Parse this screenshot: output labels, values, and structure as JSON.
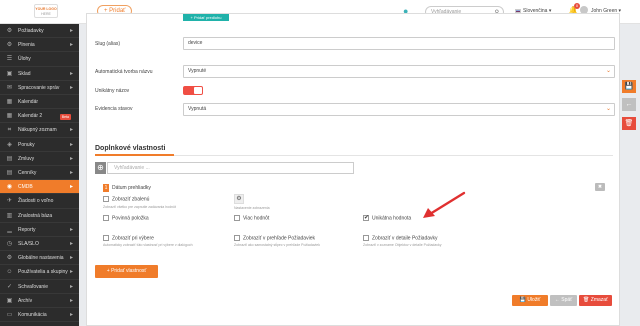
{
  "topbar": {
    "logo_line1": "YOUR LOGO",
    "logo_line2": "HERE",
    "add_button": "+ Pridať",
    "search_placeholder": "Vyhľadávanie",
    "language": "Slovenčina",
    "notification_count": "0",
    "user_name": "John Green"
  },
  "sidebar": {
    "items": [
      {
        "label": "Požiadavky",
        "icon": "gear-icon",
        "chevron": true
      },
      {
        "label": "Plnenia",
        "icon": "cogs-icon",
        "chevron": true
      },
      {
        "label": "Úlohy",
        "icon": "tasks-icon",
        "chevron": false
      },
      {
        "label": "Sklad",
        "icon": "box-icon",
        "chevron": true
      },
      {
        "label": "Spracovanie správ",
        "icon": "envelope-icon",
        "chevron": true
      },
      {
        "label": "Kalendár",
        "icon": "calendar-icon",
        "chevron": false
      },
      {
        "label": "Kalendár 2",
        "icon": "calendar-icon",
        "chevron": false,
        "badge": "Beta"
      },
      {
        "label": "Nákupný zoznam",
        "icon": "cart-icon",
        "chevron": true
      },
      {
        "label": "Ponuky",
        "icon": "tag-icon",
        "chevron": true
      },
      {
        "label": "Zmluvy",
        "icon": "document-icon",
        "chevron": true
      },
      {
        "label": "Cenníky",
        "icon": "pricelist-icon",
        "chevron": true
      },
      {
        "label": "CMDB",
        "icon": "database-icon",
        "chevron": true,
        "active": true
      },
      {
        "label": "Žiadosti o voľno",
        "icon": "plane-icon",
        "chevron": false
      },
      {
        "label": "Znalostná báza",
        "icon": "book-icon",
        "chevron": false
      },
      {
        "label": "Reporty",
        "icon": "chart-icon",
        "chevron": true
      },
      {
        "label": "SLA/SLO",
        "icon": "clock-icon",
        "chevron": true
      },
      {
        "label": "Globálne nastavenia",
        "icon": "settings-icon",
        "chevron": true
      },
      {
        "label": "Používatelia a skupiny",
        "icon": "users-icon",
        "chevron": true
      },
      {
        "label": "Schvaľovanie",
        "icon": "check-icon",
        "chevron": true
      },
      {
        "label": "Archív",
        "icon": "archive-icon",
        "chevron": true
      },
      {
        "label": "Komunikácia",
        "icon": "chat-icon",
        "chevron": true
      }
    ]
  },
  "form": {
    "teal_button": "+ Pridať predlohu",
    "slug_label": "Slug (alias)",
    "slug_value": "device",
    "auto_name_label": "Automatická tvorba názvu",
    "auto_name_value": "Vypnuté",
    "unique_name_label": "Unikátny názov",
    "state_label": "Evidencia stavov",
    "state_value": "Vypnutá"
  },
  "extra": {
    "section_title": "Doplnkové vlastnosti",
    "search_placeholder": "Vyhľadávanie ...",
    "prop_number": "1",
    "prop_name": "Dátum prehliadky",
    "cb_show_collapsed": "Zobraziť zbalenú",
    "cb_show_collapsed_help": "Zobraziť všetko pre zapnutie zadávania hodnôt",
    "gear_help": "Nastavenie zobrazenia",
    "cb_required": "Povinná položka",
    "cb_multi": "Viac hodnôt",
    "cb_unique": "Unikátna hodnota",
    "cb_show_select": "Zobraziť pri výbere",
    "cb_show_select_help": "Automaticky zobraziť túto vlastnosť pri výbere v dialógoch",
    "cb_show_overview": "Zobraziť v prehľade Požiadaviek",
    "cb_show_overview_help": "Zobraziť ako samostatný stĺpec v prehľade Požiadaviek",
    "cb_show_detail": "Zobraziť v detaile Požiadavky",
    "cb_show_detail_help": "Zobraziť v zozname Objektov v detaile Požiadavky",
    "add_property": "+ Pridať vlastnosť"
  },
  "actions": {
    "save": "Uložiť",
    "back": "Späť",
    "delete": "Zmazať"
  },
  "colors": {
    "accent": "#f07c2a",
    "danger": "#e74c3c",
    "teal": "#20b2aa"
  }
}
